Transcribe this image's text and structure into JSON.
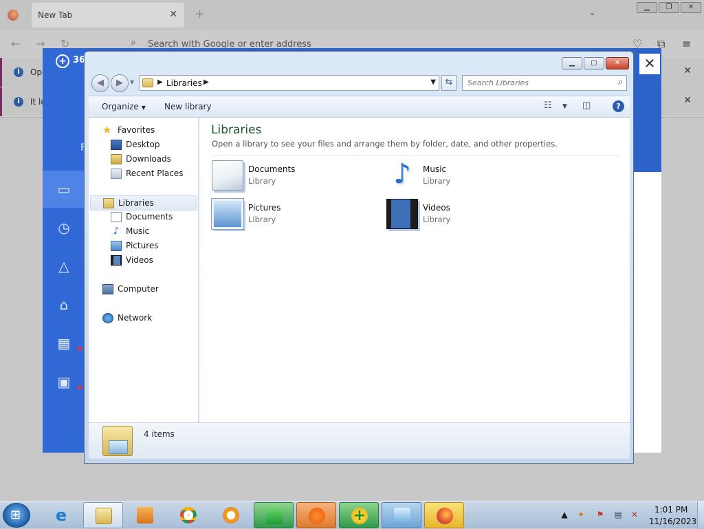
{
  "browser": {
    "tab_title": "New Tab",
    "tab_close": "✕",
    "new_tab": "+",
    "tab_list": "⌄",
    "url_placeholder": "Search with Google or enter address",
    "notices": [
      {
        "text": "Ope",
        "close": "✕"
      },
      {
        "text": "It lo",
        "close": "✕"
      }
    ]
  },
  "security_app": {
    "logo_text": "36",
    "side_text": "F",
    "close": "✕"
  },
  "explorer": {
    "address": {
      "location": "Libraries"
    },
    "search_placeholder": "Search Libraries",
    "command_bar": {
      "organize": "Organize",
      "new_library": "New library"
    },
    "nav": {
      "favorites": {
        "label": "Favorites",
        "items": [
          "Desktop",
          "Downloads",
          "Recent Places"
        ]
      },
      "libraries": {
        "label": "Libraries",
        "items": [
          "Documents",
          "Music",
          "Pictures",
          "Videos"
        ]
      },
      "computer": "Computer",
      "network": "Network"
    },
    "main": {
      "title": "Libraries",
      "subtitle": "Open a library to see your files and arrange them by folder, date, and other properties.",
      "libraries": [
        {
          "name": "Documents",
          "type": "Library",
          "icon": "documents-icon"
        },
        {
          "name": "Music",
          "type": "Library",
          "icon": "music-icon"
        },
        {
          "name": "Pictures",
          "type": "Library",
          "icon": "pictures-icon"
        },
        {
          "name": "Videos",
          "type": "Library",
          "icon": "videos-icon"
        }
      ]
    },
    "details": {
      "count": "4 items"
    }
  },
  "taskbar": {
    "clock_time": "1:01 PM",
    "clock_date": "11/16/2023"
  }
}
